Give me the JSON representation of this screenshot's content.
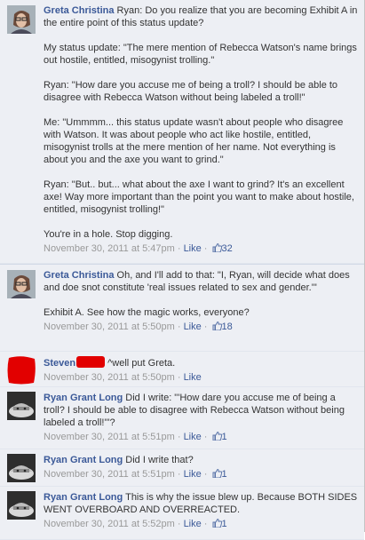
{
  "comments": [
    {
      "author": "Greta Christina",
      "first_line": "Ryan: Do you realize that you are becoming Exhibit A in the entire point of this status update?",
      "paragraphs": [
        "My status update: \"The mere mention of Rebecca Watson's name brings out hostile, entitled, misogynist trolling.\"",
        "Ryan: \"How dare you accuse me of being a troll? I should be able to disagree with Rebecca Watson without being labeled a troll!\"",
        "Me: \"Ummmm... this status update wasn't about people who disagree with Watson. It was about people who act like hostile, entitled, misogynist trolls at the mere mention of her name. Not everything is about you and the axe you want to grind.\"",
        "Ryan: \"But.. but... what about the axe I want to grind? It's an excellent axe! Way more important than the point you want to make about hostile, entitled, misogynist trolling!\"",
        "You're in a hole. Stop digging."
      ],
      "timestamp": "November 30, 2011 at 5:47pm",
      "sep": " · ",
      "like_label": "Like",
      "like_count": "32"
    },
    {
      "author": "Greta Christina",
      "first_line": "Oh, and I'll add to that: \"I, Ryan, will decide what does and doe snot constitute 'real issues related to sex and gender.'\"",
      "paragraphs": [
        "Exhibit A. See how the magic works, everyone?"
      ],
      "timestamp": "November 30, 2011 at 5:50pm",
      "sep": " · ",
      "like_label": "Like",
      "like_count": "18"
    },
    {
      "author": "Steven",
      "first_line": "^well put Greta.",
      "timestamp": "November 30, 2011 at 5:50pm",
      "sep": " · ",
      "like_label": "Like"
    },
    {
      "author": "Ryan Grant Long",
      "first_line": "Did I write: \"'How dare you accuse me of being a troll? I should be able to disagree with Rebecca Watson without being labeled a troll!'\"?",
      "timestamp": "November 30, 2011 at 5:51pm",
      "sep": " · ",
      "like_label": "Like",
      "like_count": "1"
    },
    {
      "author": "Ryan Grant Long",
      "first_line": "Did I write that?",
      "timestamp": "November 30, 2011 at 5:51pm",
      "sep": " · ",
      "like_label": "Like",
      "like_count": "1"
    },
    {
      "author": "Ryan Grant Long",
      "first_line": "This is why the issue blew up. Because BOTH SIDES WENT OVERBOARD AND OVERREACTED.",
      "timestamp": "November 30, 2011 at 5:52pm",
      "sep": " · ",
      "like_label": "Like",
      "like_count": "1"
    }
  ],
  "colors": {
    "link": "#3b5998",
    "meta": "#999999",
    "comment_bg": "#edeff4",
    "redaction": "#e20000"
  },
  "icons": {
    "like": "thumbs-up-icon"
  }
}
